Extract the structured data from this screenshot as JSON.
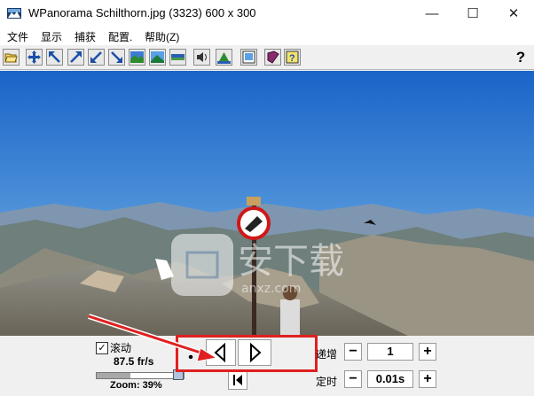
{
  "window": {
    "title": "WPanorama  Schilthorn.jpg   (3323) 600 x 300",
    "minimize_glyph": "—",
    "maximize_glyph": "☐",
    "close_glyph": "✕"
  },
  "menu": {
    "items": [
      {
        "label": "文件"
      },
      {
        "label": "显示"
      },
      {
        "label": "捕获"
      },
      {
        "label": "配置."
      },
      {
        "label": "帮助(Z)"
      }
    ]
  },
  "toolbar": {
    "buttons": [
      {
        "icon": "open-file-icon"
      },
      {
        "icon": "move-all-directions-icon"
      },
      {
        "icon": "arrow-up-left-icon"
      },
      {
        "icon": "arrow-diagonal-up-icon"
      },
      {
        "icon": "arrow-diagonal-down-icon"
      },
      {
        "icon": "arrow-down-right-icon"
      },
      {
        "icon": "landscape-view-icon"
      },
      {
        "icon": "landscape-gradient-icon"
      },
      {
        "icon": "panorama-strip-icon"
      },
      {
        "icon": "speaker-icon"
      },
      {
        "icon": "mountain-peak-icon"
      },
      {
        "icon": "screen-capture-icon"
      },
      {
        "icon": "book-icon"
      },
      {
        "icon": "help-book-icon"
      }
    ],
    "help_label": "?"
  },
  "watermark": {
    "text": "安下载",
    "subtext": "anxz.com"
  },
  "controls": {
    "scroll_checkbox_label": "滚动",
    "scroll_checked": true,
    "speed": "87.5 fr/s",
    "zoom_label": "Zoom: 39%",
    "zoom_level_percent": 39,
    "increment_label": "递增",
    "increment_value": "1",
    "timer_label": "定时",
    "timer_value": "0.01s",
    "minus": "−",
    "plus": "+"
  },
  "colors": {
    "highlight_red": "#e02020"
  }
}
